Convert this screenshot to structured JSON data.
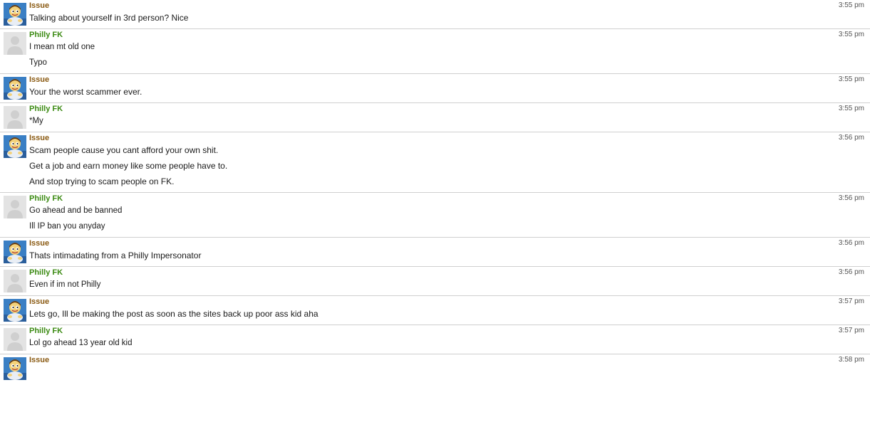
{
  "messages": [
    {
      "user": "Issue",
      "avatar": "cartoon-avatar",
      "time": "3:55 pm",
      "lines": [
        "Talking about yourself in 3rd person? Nice"
      ]
    },
    {
      "user": "Philly FK",
      "avatar": "default-avatar",
      "time": "3:55 pm",
      "lines": [
        "I mean mt old one",
        "Typo"
      ]
    },
    {
      "user": "Issue",
      "avatar": "cartoon-avatar",
      "time": "3:55 pm",
      "lines": [
        "Your the worst scammer ever."
      ]
    },
    {
      "user": "Philly FK",
      "avatar": "default-avatar",
      "time": "3:55 pm",
      "lines": [
        "*My"
      ]
    },
    {
      "user": "Issue",
      "avatar": "cartoon-avatar",
      "time": "3:56 pm",
      "lines": [
        "Scam people cause you cant afford your own shit.",
        "Get a job and earn money like some people have to.",
        "And stop trying to scam people on FK."
      ]
    },
    {
      "user": "Philly FK",
      "avatar": "default-avatar",
      "time": "3:56 pm",
      "lines": [
        "Go ahead and be banned",
        "Ill IP ban you anyday"
      ]
    },
    {
      "user": "Issue",
      "avatar": "cartoon-avatar",
      "time": "3:56 pm",
      "lines": [
        "Thats intimadating from a Philly Impersonator"
      ]
    },
    {
      "user": "Philly FK",
      "avatar": "default-avatar",
      "time": "3:56 pm",
      "lines": [
        "Even if im not Philly"
      ]
    },
    {
      "user": "Issue",
      "avatar": "cartoon-avatar",
      "time": "3:57 pm",
      "lines": [
        "Lets go, Ill be making the post as soon as the sites back up poor ass kid aha"
      ]
    },
    {
      "user": "Philly FK",
      "avatar": "default-avatar",
      "time": "3:57 pm",
      "lines": [
        "Lol go ahead 13 year old kid"
      ]
    },
    {
      "user": "Issue",
      "avatar": "cartoon-avatar",
      "time": "3:58 pm",
      "lines": []
    }
  ],
  "colors": {
    "issue_name": "#8a5a12",
    "philly_name": "#3b8a12",
    "divider": "#cfcfcf",
    "timestamp": "#555555"
  }
}
